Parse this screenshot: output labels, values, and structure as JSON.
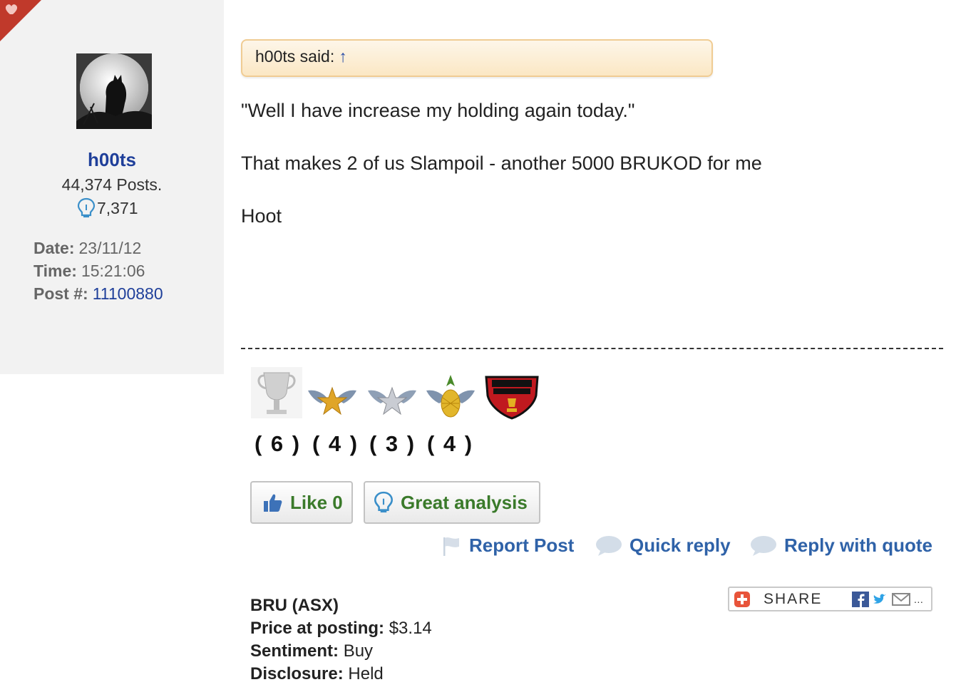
{
  "quote": {
    "author_said": "h00ts said:",
    "arrow": "↑"
  },
  "user": {
    "name": "h00ts",
    "posts": "44,374 Posts.",
    "lightbulbs": "7,371"
  },
  "meta": {
    "date_label": "Date:",
    "date": "23/11/12",
    "time_label": "Time:",
    "time": "15:21:06",
    "post_label": "Post #:",
    "post_id": "11100880"
  },
  "post": {
    "line1": "\"Well I have increase my holding again today.\"",
    "line2": "That makes 2 of us Slampoil - another 5000 BRUKOD for me",
    "line3": "Hoot"
  },
  "badges": {
    "counts": [
      "( 6 )",
      "( 4 )",
      "( 3 )",
      "( 4 )"
    ]
  },
  "buttons": {
    "like": "Like 0",
    "great_analysis": "Great analysis"
  },
  "actions": {
    "report": "Report Post",
    "quick_reply": "Quick reply",
    "reply_quote": "Reply with quote"
  },
  "share": {
    "label": "SHARE"
  },
  "stock": {
    "ticker": "BRU (ASX)",
    "price_label": "Price at posting:",
    "price": "$3.14",
    "sentiment_label": "Sentiment:",
    "sentiment": "Buy",
    "disclosure_label": "Disclosure:",
    "disclosure": "Held"
  },
  "colors": {
    "link": "#1f3f9a",
    "action": "#2f62a8",
    "green": "#3a7a2a",
    "quote_border": "#f0cc93"
  }
}
